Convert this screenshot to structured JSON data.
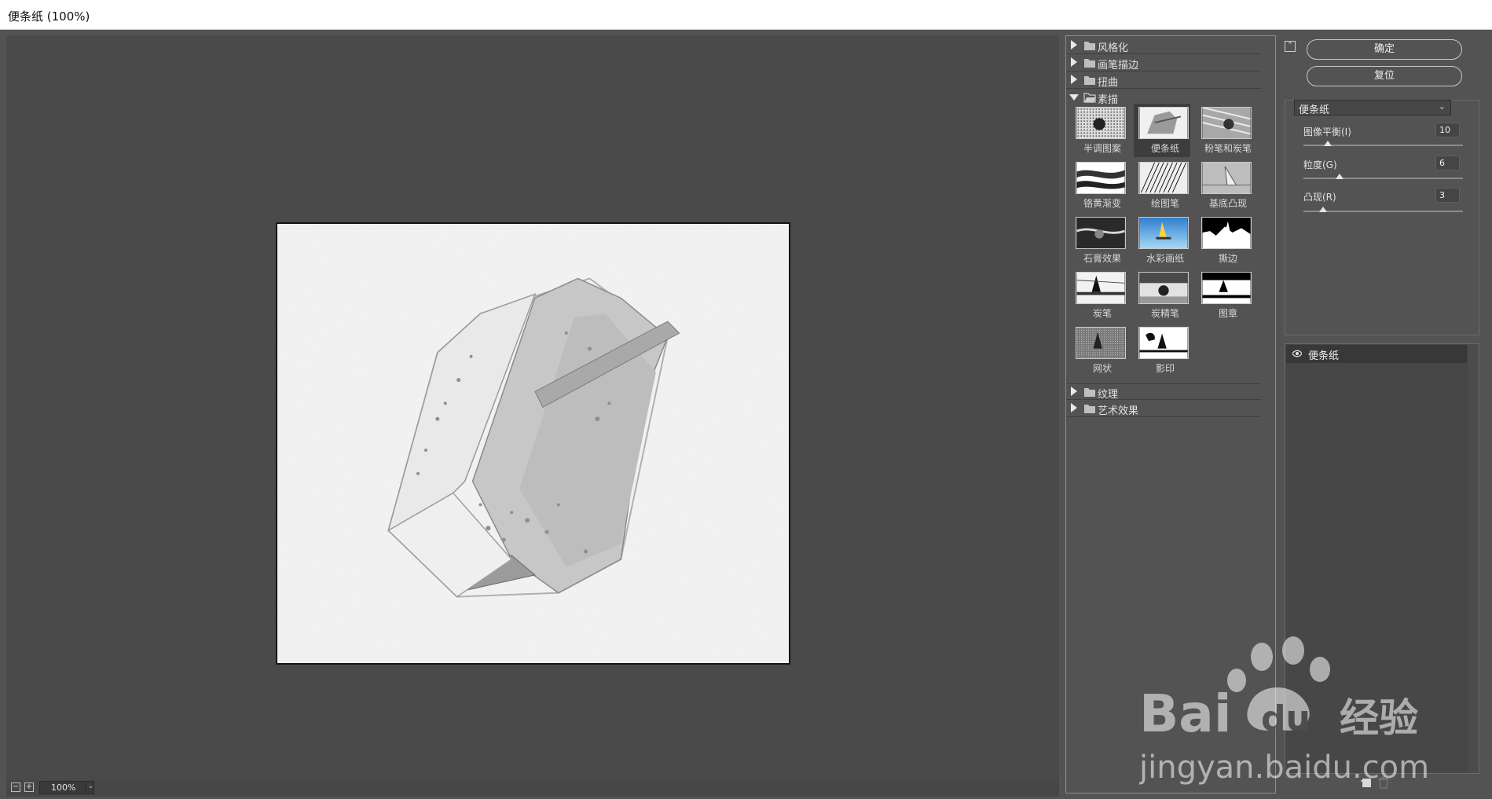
{
  "window": {
    "title": "便条纸 (100%)"
  },
  "preview": {
    "zoom_value": "100%",
    "zoom_out_label": "−",
    "zoom_in_label": "+",
    "zoom_drop": "⌄"
  },
  "gallery": {
    "categories_top": [
      {
        "label": "风格化",
        "expanded": false
      },
      {
        "label": "画笔描边",
        "expanded": false
      },
      {
        "label": "扭曲",
        "expanded": false
      },
      {
        "label": "素描",
        "expanded": true
      }
    ],
    "sketch_filters": [
      {
        "label": "半调图案",
        "icon": "halftone-pattern-thumb"
      },
      {
        "label": "便条纸",
        "icon": "note-paper-thumb",
        "selected": true
      },
      {
        "label": "粉笔和炭笔",
        "icon": "chalk-charcoal-thumb"
      },
      {
        "label": "铬黄渐变",
        "icon": "chrome-thumb"
      },
      {
        "label": "绘图笔",
        "icon": "graphic-pen-thumb"
      },
      {
        "label": "基底凸现",
        "icon": "bas-relief-thumb"
      },
      {
        "label": "石膏效果",
        "icon": "plaster-thumb"
      },
      {
        "label": "水彩画纸",
        "icon": "water-paper-thumb"
      },
      {
        "label": "撕边",
        "icon": "torn-edges-thumb"
      },
      {
        "label": "炭笔",
        "icon": "charcoal-thumb"
      },
      {
        "label": "炭精笔",
        "icon": "conte-crayon-thumb"
      },
      {
        "label": "图章",
        "icon": "stamp-thumb"
      },
      {
        "label": "网状",
        "icon": "reticulation-thumb"
      },
      {
        "label": "影印",
        "icon": "photocopy-thumb"
      }
    ],
    "categories_bottom": [
      {
        "label": "纹理",
        "expanded": false
      },
      {
        "label": "艺术效果",
        "expanded": false
      }
    ]
  },
  "panel": {
    "collapse_label": "⌃",
    "ok_label": "确定",
    "reset_label": "复位",
    "filter_select_value": "便条纸",
    "select_chevron": "⌄",
    "params": [
      {
        "label": "图像平衡(I)",
        "value": "10",
        "level": 0.13
      },
      {
        "label": "粒度(G)",
        "value": "6",
        "level": 0.2
      },
      {
        "label": "凸现(R)",
        "value": "3",
        "level": 0.1
      }
    ],
    "layers": [
      {
        "name": "便条纸",
        "visible": true
      }
    ]
  },
  "watermark": {
    "brand": "Bai",
    "brand_suffix": "经验",
    "url": "jingyan.baidu.com"
  }
}
